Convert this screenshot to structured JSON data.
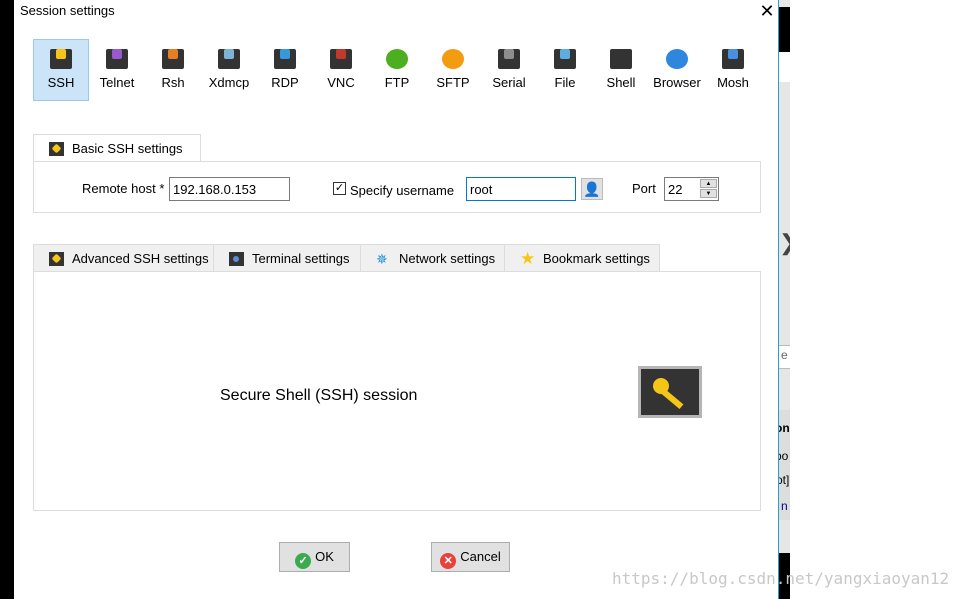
{
  "window": {
    "title": "Session settings",
    "close_icon": "close-icon"
  },
  "protocols": [
    {
      "label": "SSH",
      "icon": "ssh-key-icon",
      "color": "#f5c518",
      "selected": true
    },
    {
      "label": "Telnet",
      "icon": "telnet-gem-icon",
      "color": "#9b59d0"
    },
    {
      "label": "Rsh",
      "icon": "rsh-gears-icon",
      "color": "#e67e22"
    },
    {
      "label": "Xdmcp",
      "icon": "xdmcp-monitor-icon",
      "color": "#7fb3d5"
    },
    {
      "label": "RDP",
      "icon": "rdp-monitor-icon",
      "color": "#3498db"
    },
    {
      "label": "VNC",
      "icon": "vnc-monitor-icon",
      "color": "#c0392b"
    },
    {
      "label": "FTP",
      "icon": "ftp-globe-icon",
      "color": "#4caf1f"
    },
    {
      "label": "SFTP",
      "icon": "sftp-globe-icon",
      "color": "#f39c12"
    },
    {
      "label": "Serial",
      "icon": "serial-plug-icon",
      "color": "#8e8e8e"
    },
    {
      "label": "File",
      "icon": "file-monitor-icon",
      "color": "#5dade2"
    },
    {
      "label": "Shell",
      "icon": "shell-terminal-icon",
      "color": "#333333"
    },
    {
      "label": "Browser",
      "icon": "browser-globe-icon",
      "color": "#2e86de"
    },
    {
      "label": "Mosh",
      "icon": "mosh-satellite-icon",
      "color": "#4a90e2"
    }
  ],
  "basic": {
    "tab_label": "Basic SSH settings",
    "remote_host_label": "Remote host *",
    "remote_host_value": "192.168.0.153",
    "specify_username_label": "Specify username",
    "specify_username_checked": true,
    "username_value": "root",
    "port_label": "Port",
    "port_value": "22"
  },
  "advanced_tabs": [
    {
      "label": "Advanced SSH settings",
      "icon": "key-icon"
    },
    {
      "label": "Terminal settings",
      "icon": "terminal-icon"
    },
    {
      "label": "Network settings",
      "icon": "network-icon"
    },
    {
      "label": "Bookmark settings",
      "icon": "star-icon"
    }
  ],
  "description": "Secure Shell (SSH) session",
  "buttons": {
    "ok": "OK",
    "cancel": "Cancel"
  },
  "background_fragments": [
    "e",
    "on",
    "oo",
    "ot]",
    "n"
  ],
  "watermark": "https://blog.csdn.net/yangxiaoyan12"
}
